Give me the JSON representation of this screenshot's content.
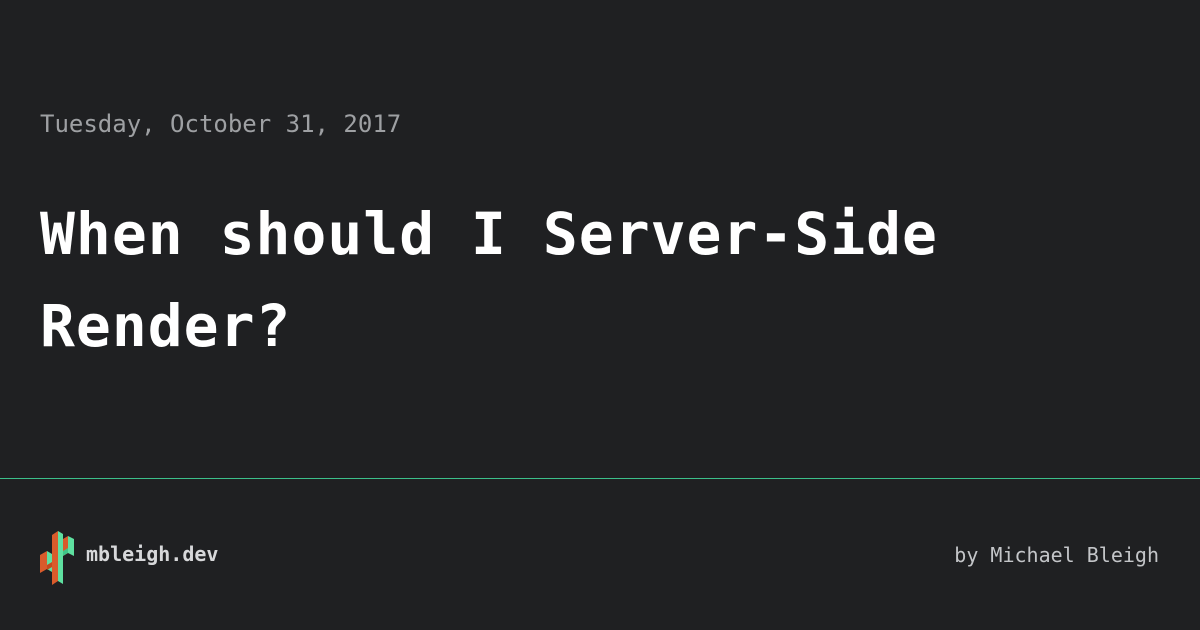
{
  "post": {
    "date": "Tuesday, October 31, 2017",
    "title": "When should I Server-Side Render?"
  },
  "footer": {
    "site_name": "mbleigh.dev",
    "byline": "by Michael Bleigh",
    "logo_icon": "cactus-logo-icon",
    "divider_color": "#3bbf8a"
  },
  "colors": {
    "background": "#1f2022",
    "logo_orange": "#d95b2b",
    "logo_green": "#5ee0a0"
  }
}
